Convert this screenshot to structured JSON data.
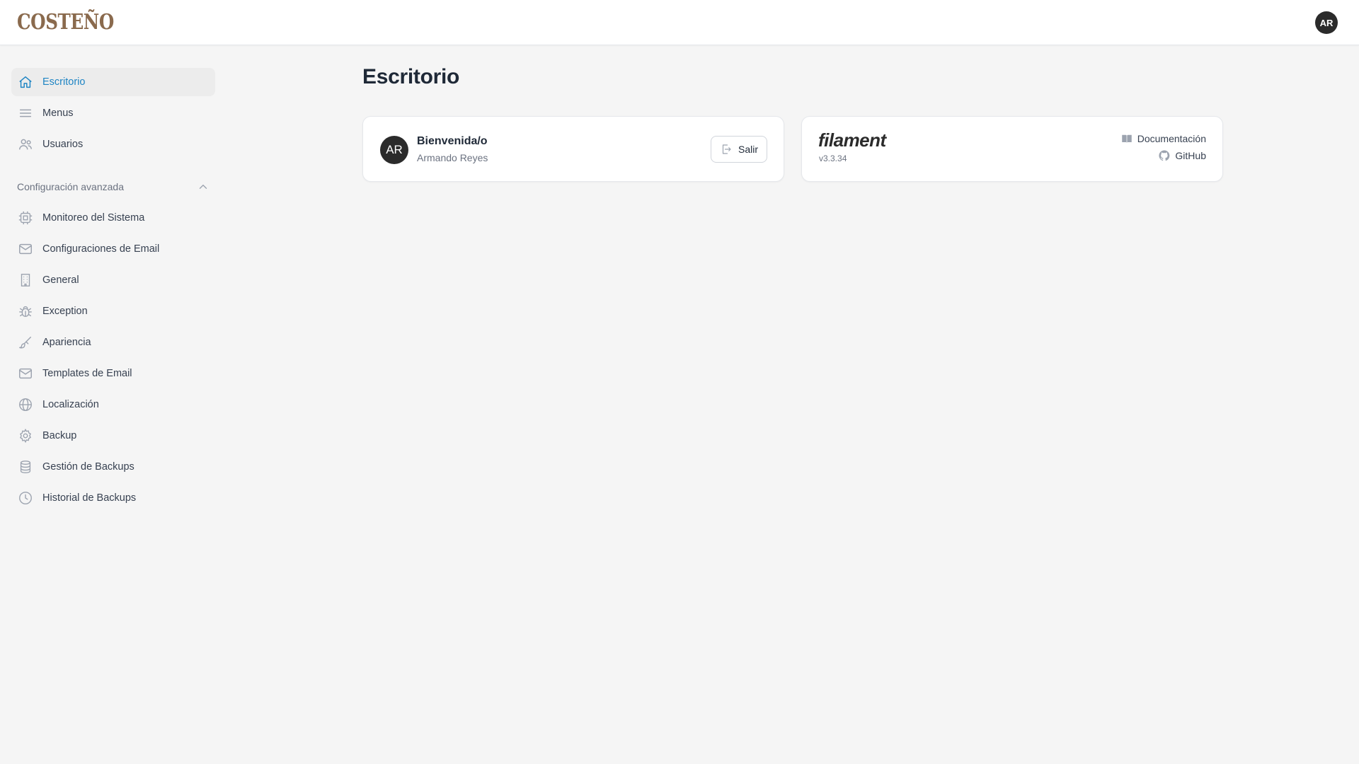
{
  "app": {
    "logo_text": "COSTEÑO",
    "user_initials": "AR",
    "accent_color": "#1f85c4",
    "logo_color": "#8a6a4d"
  },
  "sidebar": {
    "items": [
      {
        "label": "Escritorio",
        "icon": "home-icon",
        "active": true
      },
      {
        "label": "Menus",
        "icon": "bars-icon"
      },
      {
        "label": "Usuarios",
        "icon": "users-icon"
      }
    ],
    "group": {
      "label": "Configuración avanzada",
      "icon": "chevron-up-icon",
      "items": [
        {
          "label": "Monitoreo del Sistema",
          "icon": "cpu-chip-icon"
        },
        {
          "label": "Configuraciones de Email",
          "icon": "envelope-icon"
        },
        {
          "label": "General",
          "icon": "building-icon"
        },
        {
          "label": "Exception",
          "icon": "bug-icon"
        },
        {
          "label": "Apariencia",
          "icon": "paint-brush-icon"
        },
        {
          "label": "Templates de Email",
          "icon": "envelope-icon"
        },
        {
          "label": "Localización",
          "icon": "globe-icon"
        },
        {
          "label": "Backup",
          "icon": "cog-icon"
        },
        {
          "label": "Gestión de Backups",
          "icon": "database-icon"
        },
        {
          "label": "Historial de Backups",
          "icon": "clock-icon"
        }
      ]
    }
  },
  "main": {
    "title": "Escritorio",
    "account_widget": {
      "avatar_initials": "AR",
      "greeting": "Bienvenida/o",
      "user_name": "Armando Reyes",
      "logout_label": "Salir"
    },
    "filament_widget": {
      "logo_text": "filament",
      "version": "v3.3.34",
      "docs_label": "Documentación",
      "github_label": "GitHub"
    }
  }
}
